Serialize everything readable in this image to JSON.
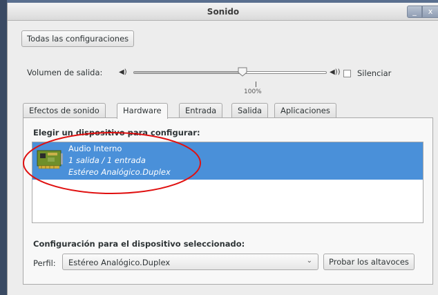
{
  "window": {
    "title": "Sonido",
    "minimize_glyph": "_",
    "close_glyph": "x"
  },
  "toolbar": {
    "all_settings_label": "Todas las configuraciones"
  },
  "output_volume": {
    "label": "Volumen de salida:",
    "level_percent": 57,
    "mark_label": "100%",
    "mute_label": "Silenciar",
    "muted": false,
    "low_icon": "speaker-low-icon",
    "high_icon": "speaker-high-icon"
  },
  "tabs": [
    {
      "label": "Efectos de sonido",
      "active": false
    },
    {
      "label": "Hardware",
      "active": true
    },
    {
      "label": "Entrada",
      "active": false
    },
    {
      "label": "Salida",
      "active": false
    },
    {
      "label": "Aplicaciones",
      "active": false
    }
  ],
  "hardware": {
    "choose_heading": "Elegir un dispositivo para configurar:",
    "devices": [
      {
        "name": "Audio Interno",
        "ports": "1 salida / 1 entrada",
        "profile": "Estéreo Analógico.Duplex",
        "icon": "sound-card-icon",
        "selected": true
      }
    ],
    "config_heading": "Configuración para el dispositivo seleccionado:",
    "profile_label": "Perfil:",
    "profile_value": "Estéreo Analógico.Duplex",
    "test_speakers_label": "Probar los altavoces"
  },
  "colors": {
    "selection": "#4a90d9",
    "annotation": "#e01010"
  }
}
